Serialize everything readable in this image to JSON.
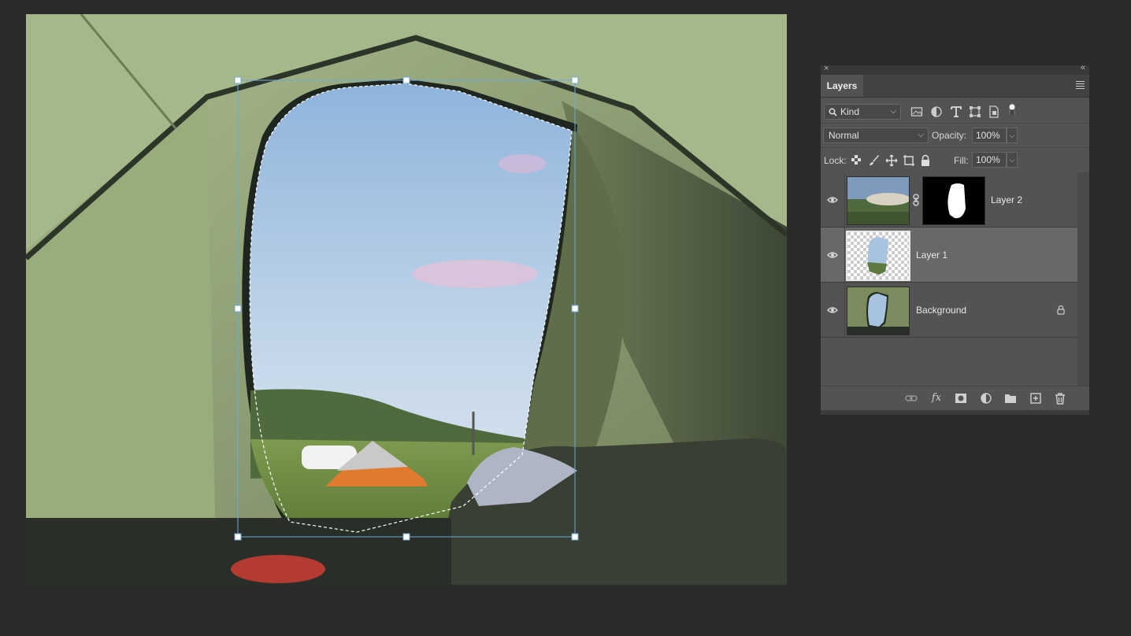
{
  "panel": {
    "close_glyph": "×",
    "collapse_glyph": "«",
    "tab_label": "Layers",
    "filter": {
      "kind_label": "Kind"
    },
    "blend_mode": "Normal",
    "opacity_label": "Opacity:",
    "opacity_value": "100%",
    "lock_label": "Lock:",
    "fill_label": "Fill:",
    "fill_value": "100%",
    "layers": [
      {
        "name": "Layer 2",
        "visible": true,
        "has_mask": true,
        "selected": false,
        "locked": false
      },
      {
        "name": "Layer 1",
        "visible": true,
        "has_mask": false,
        "selected": true,
        "locked": false
      },
      {
        "name": "Background",
        "visible": true,
        "has_mask": false,
        "selected": false,
        "locked": true
      }
    ],
    "bottom_icons": [
      "link-icon",
      "fx-icon",
      "mask-icon",
      "adjustment-icon",
      "folder-icon",
      "new-layer-icon",
      "trash-icon"
    ],
    "fx_label": "fx"
  },
  "colors": {
    "app_bg": "#2b2b2b",
    "panel_bg": "#535353",
    "selected_row": "#686868",
    "transform_handle": "#6fa8dc"
  }
}
